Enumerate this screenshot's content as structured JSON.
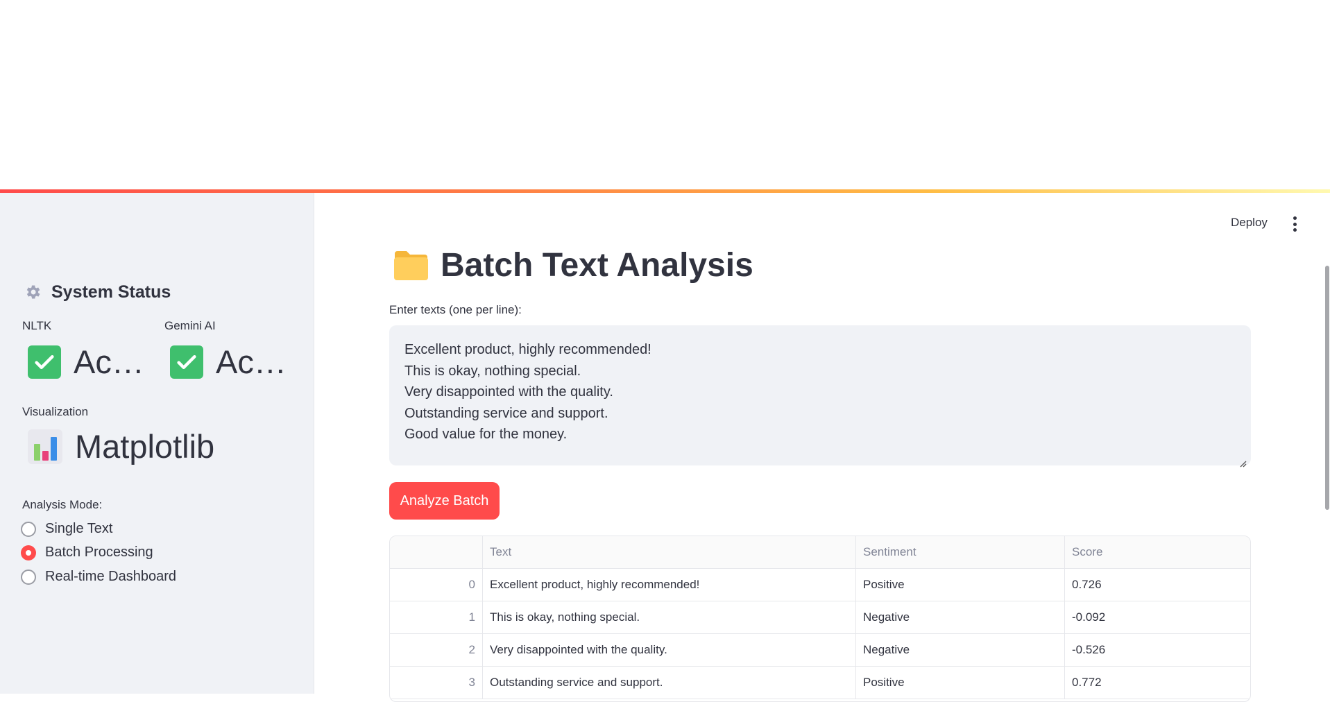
{
  "header": {
    "deploy_label": "Deploy"
  },
  "sidebar": {
    "section_title": "System Status",
    "metrics": [
      {
        "label": "NLTK",
        "value": "Ac…"
      },
      {
        "label": "Gemini AI",
        "value": "Ac…"
      },
      {
        "label": "Visualization",
        "value": "Matplotlib"
      }
    ],
    "mode_label": "Analysis Mode:",
    "modes": [
      {
        "label": "Single Text",
        "selected": false
      },
      {
        "label": "Batch Processing",
        "selected": true
      },
      {
        "label": "Real-time Dashboard",
        "selected": false
      }
    ]
  },
  "main": {
    "title": "Batch Text Analysis",
    "input_label": "Enter texts (one per line):",
    "textarea_lines": [
      "Excellent product, highly recommended!",
      "This is okay, nothing special.",
      "Very disappointed with the quality.",
      "Outstanding service and support.",
      "Good value for the money."
    ],
    "analyze_button": "Analyze Batch",
    "table": {
      "columns": [
        "",
        "Text",
        "Sentiment",
        "Score"
      ],
      "rows": [
        [
          "0",
          "Excellent product, highly recommended!",
          "Positive",
          "0.726"
        ],
        [
          "1",
          "This is okay, nothing special.",
          "Negative",
          "-0.092"
        ],
        [
          "2",
          "Very disappointed with the quality.",
          "Negative",
          "-0.526"
        ],
        [
          "3",
          "Outstanding service and support.",
          "Positive",
          "0.772"
        ]
      ]
    }
  },
  "colors": {
    "accent": "#ff4b4b",
    "sidebar_bg": "#f0f2f6",
    "check_green": "#3fbf6d"
  },
  "icons": [
    "gear-icon",
    "check-icon",
    "bar-chart-icon",
    "folder-icon",
    "menu-dots-icon"
  ]
}
